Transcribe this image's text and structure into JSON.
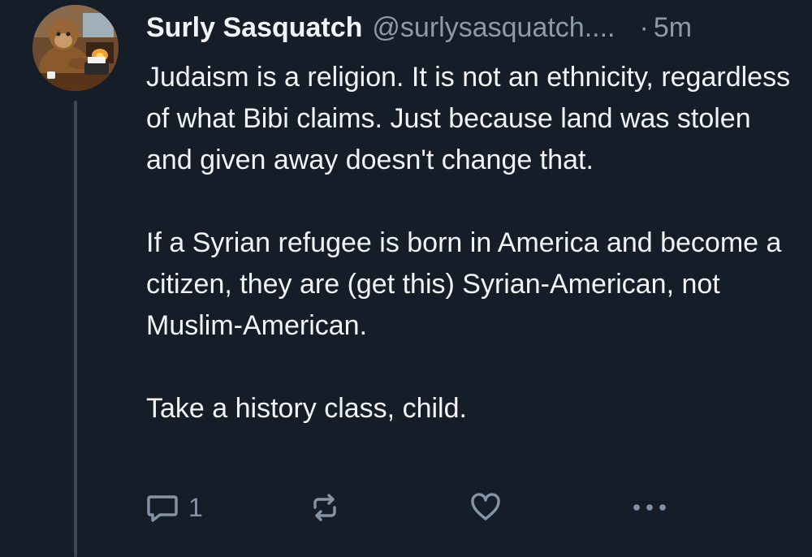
{
  "post": {
    "author": {
      "display_name": "Surly Sasquatch",
      "handle": "@surlysasquatch....",
      "avatar_icon": "sasquatch-at-typewriter-avatar"
    },
    "separator": "·",
    "timestamp": "5m",
    "paragraphs": [
      "Judaism is a religion. It is not an ethnicity, regardless of what Bibi claims. Just because land was stolen and given away doesn't change that.",
      "If a Syrian refugee is born in America and become a citizen, they are (get this) Syrian-American, not Muslim-American.",
      "Take a history class, child."
    ],
    "actions": {
      "reply": {
        "icon": "reply-bubble-icon",
        "count": "1"
      },
      "repost": {
        "icon": "repost-icon"
      },
      "like": {
        "icon": "heart-icon"
      },
      "more": {
        "icon": "more-dots-icon"
      }
    }
  },
  "colors": {
    "background": "#151d28",
    "text_primary": "#f1f3f5",
    "text_secondary": "#8d9aab",
    "thread_line": "#3a4757"
  }
}
